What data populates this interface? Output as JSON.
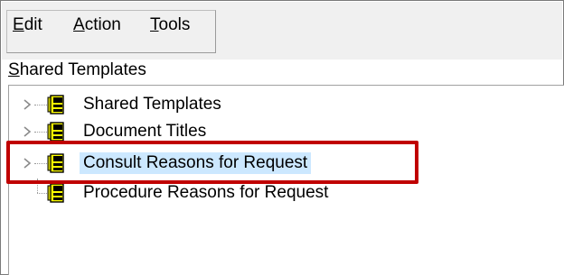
{
  "menu": {
    "edit": {
      "mnemonic": "E",
      "rest": "dit"
    },
    "action": {
      "mnemonic": "A",
      "rest": "ction"
    },
    "tools": {
      "mnemonic": "T",
      "rest": "ools"
    }
  },
  "section_label": {
    "mnemonic": "S",
    "rest": "hared Templates"
  },
  "tree": {
    "items": [
      {
        "label": "Shared Templates",
        "icon": "folder-book-icon",
        "expandable": true
      },
      {
        "label": "Document Titles",
        "icon": "folder-book-icon",
        "expandable": true
      },
      {
        "label": "Consult Reasons for Request",
        "icon": "folder-book-icon",
        "expandable": true,
        "selected": true
      },
      {
        "label": "Procedure Reasons for Request",
        "icon": "folder-book-icon",
        "expandable": false
      }
    ]
  },
  "colors": {
    "selection": "#cce8ff",
    "highlight_box": "#c00000",
    "icon_yellow": "#ffff00",
    "icon_dark": "#000000"
  }
}
